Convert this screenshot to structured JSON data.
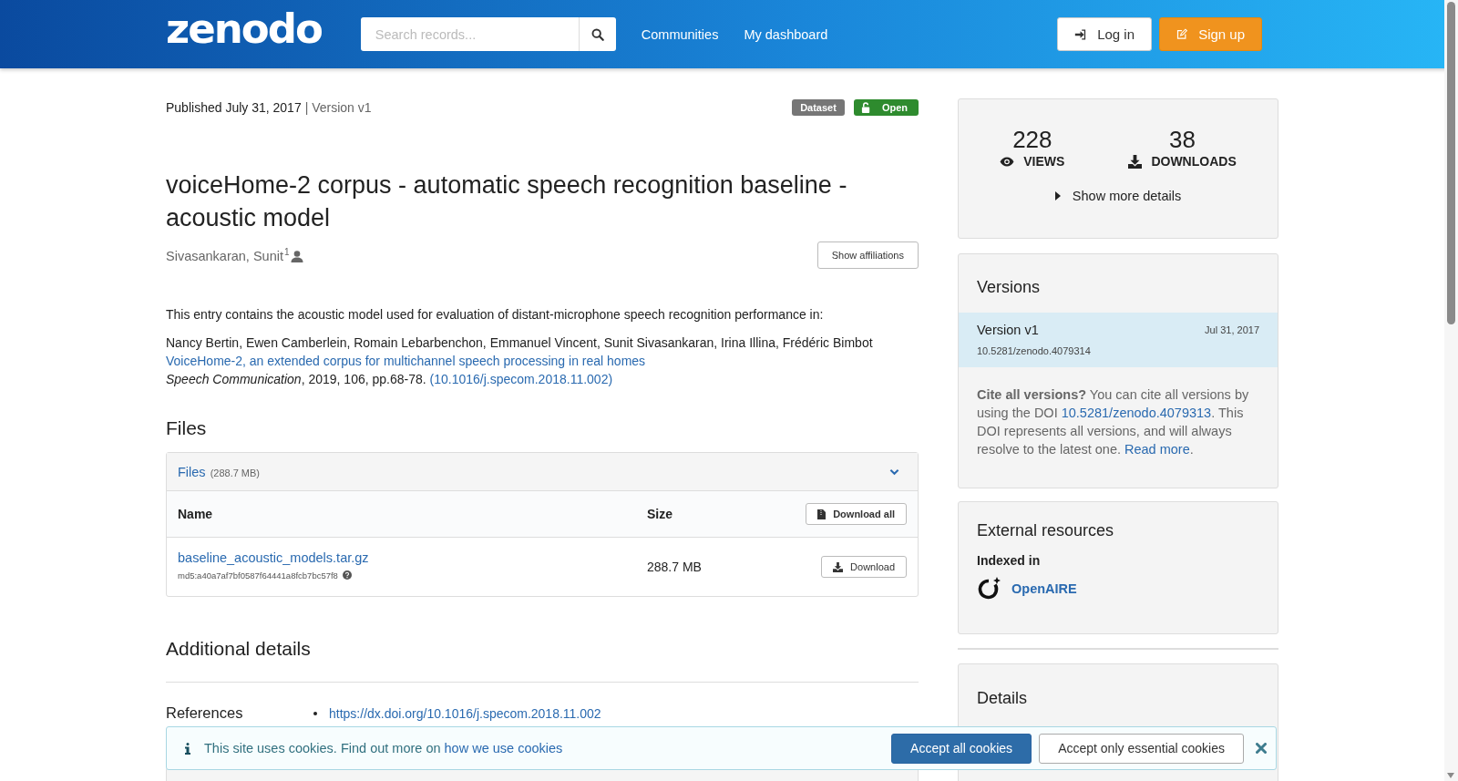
{
  "header": {
    "logo": "zenodo",
    "search": {
      "placeholder": "Search records..."
    },
    "nav": [
      "Communities",
      "My dashboard"
    ],
    "buttons": [
      {
        "label": "Log in",
        "kind": "login"
      },
      {
        "label": "Sign up",
        "kind": "signup"
      }
    ]
  },
  "record": {
    "published": "Published July 31, 2017",
    "version": "| Version v1",
    "badges": [
      {
        "label": "Dataset",
        "kind": "type"
      },
      {
        "label": "Open",
        "kind": "access"
      }
    ],
    "title": "voiceHome-2 corpus - automatic speech recognition baseline - acoustic model",
    "creators": [
      {
        "name": "Sivasankaran, Sunit",
        "affiliation": "1"
      }
    ],
    "show_affiliations": "Show affiliations",
    "description": "This entry contains the acoustic model used for evaluation of distant-microphone speech recognition performance in:",
    "citation": {
      "authors": "Nancy Bertin, Ewen Camberlein, Romain Lebarbenchon, Emmanuel Vincent, Sunit Sivasankaran, Irina Illina, Frédéric Bimbot",
      "title": "VoiceHome-2, an extended corpus for multichannel speech processing in real homes",
      "journal": "*Speech Communication*, 2019, 106, pp.68-78. ",
      "doi": "(10.1016/j.specom.2018.11.002)"
    }
  },
  "files": {
    "heading": "Files",
    "panel": {
      "title": "Files",
      "size": "(288.7 MB)",
      "expanded": true
    },
    "columns": [
      "Name",
      "Size"
    ],
    "download_all": "Download all",
    "rows": [
      {
        "name": "baseline_acoustic_models.tar.gz",
        "checksum": "md5:a40a7af7bf0587f64441a8fcb7bc57f8",
        "size": "288.7 MB",
        "button": "Download"
      }
    ]
  },
  "additional": {
    "heading": "Additional details",
    "references": {
      "label": "References",
      "items": [
        "https://dx.doi.org/10.1016/j.specom.2018.11.002"
      ]
    }
  },
  "sidebar": {
    "stats": [
      {
        "value": "228",
        "label": "VIEWS",
        "kind": "views"
      },
      {
        "value": "38",
        "label": "DOWNLOADS",
        "kind": "downloads"
      }
    ],
    "more": {
      "label": "Show more details",
      "expanded": false
    },
    "versions": {
      "heading": "Versions",
      "items": [
        {
          "label": "Version v1",
          "date": "Jul 31, 2017",
          "doi": "10.5281/zenodo.4079314",
          "selected": true
        }
      ],
      "cite_start": "**Cite all versions?** You can cite all versions by using the DOI ",
      "cite_doi": "10.5281/zenodo.4079313",
      "cite_middle": ". This DOI represents all versions, and will always resolve to the latest one. ",
      "read_more": "Read more",
      "cite_end": "."
    },
    "external": {
      "heading": "External resources",
      "indexed_label": "Indexed in",
      "items": [
        {
          "name": "OpenAIRE"
        }
      ]
    },
    "details": {
      "heading": "Details"
    }
  },
  "cookies": {
    "text": "This site uses cookies. Find out more on ",
    "link": "how we use cookies",
    "accept_all": "Accept all cookies",
    "accept_essential": "Accept only essential cookies"
  }
}
